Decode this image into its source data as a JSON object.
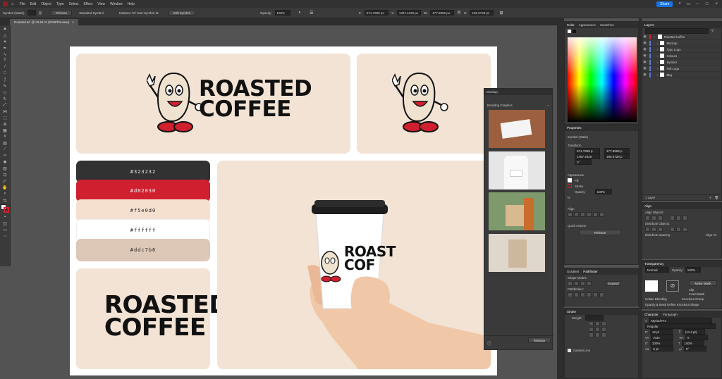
{
  "menubar": {
    "items": [
      "File",
      "Edit",
      "Object",
      "Type",
      "Select",
      "Effect",
      "View",
      "Window",
      "Help"
    ],
    "share_label": "Share"
  },
  "control": {
    "selection_label": "Symbol (Static)",
    "release_label": "Release",
    "symbol_label": "Standard Symbol",
    "instance_label": "Instance Of: Non-Symbol 11",
    "edit_symbol_label": "Edit Symbol",
    "opacity_label": "Opacity:",
    "opacity_value": "100%",
    "x_label": "X:",
    "x_value": "571.7898 px",
    "y_label": "Y:",
    "y_value": "1457.4425 px",
    "w_label": "W:",
    "w_value": "177.8965 px",
    "h_label": "H:",
    "h_value": "186.0728 px"
  },
  "document": {
    "tab_title": "Roasted.ai* @ 33.64 % (RGB/Preview)"
  },
  "artboard": {
    "brand_top": "ROASTED",
    "brand_bottom": "COFFEE",
    "cup_top": "ROAST",
    "cup_bottom": "COF",
    "swatches": [
      {
        "label": "#323232",
        "bg": "#323232",
        "fg": "#e8e8e8"
      },
      {
        "label": "#d02030",
        "bg": "#d02030",
        "fg": "#f5f5f5"
      },
      {
        "label": "#f5e0d0",
        "bg": "#f5e0d0",
        "fg": "#222222"
      },
      {
        "label": "#ffffff",
        "bg": "#ffffff",
        "fg": "#222222"
      },
      {
        "label": "#ddc7b6",
        "bg": "#ddc7b6",
        "fg": "#222222"
      }
    ]
  },
  "mockup_panel": {
    "title": "Mockup",
    "section": "Branding Graphics",
    "release_label": "Release"
  },
  "properties_panel": {
    "title": "Properties",
    "selection_label": "Symbol (Static)",
    "transform_label": "Transform",
    "x_value": "571.7898 p",
    "y_value": "1457.4425",
    "w_value": "177.8965 p",
    "h_value": "186.0728 p",
    "rotation_value": "0°",
    "appearance_label": "Appearance",
    "fill_label": "Fill",
    "stroke_label": "Stroke",
    "opacity_label": "Opacity",
    "opacity_value": "100%",
    "fx_label": "fx",
    "align_label": "Align",
    "quick_actions_label": "Quick Actions",
    "release_button": "Release"
  },
  "color_panel": {
    "tabs": [
      "Color",
      "Appearance",
      "Swatches"
    ]
  },
  "layers_panel": {
    "title": "Layers",
    "layers": [
      "Roasted Coffee",
      "Mockup",
      "Typo Logo",
      "Colours",
      "Symbol",
      "Full Logo",
      "Bkg"
    ],
    "count_label": "1 Layer"
  },
  "align_panel": {
    "title": "Align",
    "align_objects": "Align Objects:",
    "distribute_objects": "Distribute Objects:",
    "distribute_spacing": "Distribute Spacing:",
    "align_to": "Align To:"
  },
  "pathfinder_panel": {
    "tabs": [
      "Gradient",
      "Pathfinder"
    ],
    "shape_modes": "Shape Modes:",
    "pathfinders": "Pathfinders:",
    "expand_label": "Expand"
  },
  "transparency_panel": {
    "title": "Transparency",
    "mode": "Normal",
    "opacity_label": "Opacity:",
    "opacity_value": "100%",
    "make_mask": "Make Mask",
    "clip": "Clip",
    "invert_mask": "Invert Mask",
    "isolate": "Isolate Blending",
    "knockout": "Knockout Group",
    "opacity_mask": "Opacity & Mask Define Knockout Shape"
  },
  "stroke_panel": {
    "title": "Stroke",
    "weight_label": "Weight:",
    "dashed_label": "Dashed Line"
  },
  "character_panel": {
    "tabs": [
      "Character",
      "Paragraph"
    ],
    "font": "Myriad Pro",
    "style": "Regular",
    "size": "12 pt",
    "leading": "(14.4 pt)",
    "tracking": "Auto",
    "kerning": "0",
    "scale_v": "100%",
    "scale_h": "100%",
    "baseline": "0 pt",
    "rotate": "0°"
  },
  "colors": {
    "accent_blue": "#1473e6",
    "artboard_bg": "#ffffff",
    "card_beige": "#f2e3d4",
    "ui_dark": "#323232",
    "brand_red": "#d02030"
  }
}
